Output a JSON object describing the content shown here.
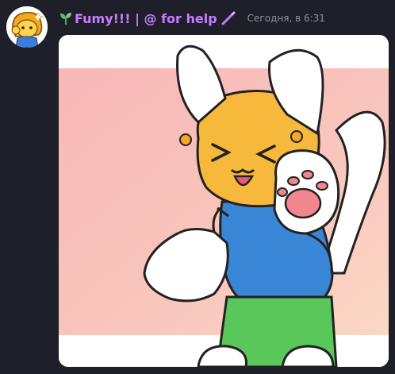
{
  "message": {
    "username_prefix_icon": "seedling-icon",
    "username": "Fumy!!! | @ for help",
    "username_suffix_icon": "pencil-icon",
    "username_color": "#c77dff",
    "timestamp": "Сегодня, в 6:31"
  },
  "avatar": {
    "icon": "cartoon-character-avatar"
  },
  "attachment": {
    "type": "image",
    "description_icon": "cartoon-cat-waving-image"
  }
}
